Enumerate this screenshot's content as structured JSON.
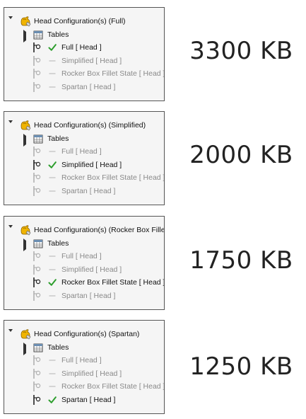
{
  "panels": [
    {
      "root_label": "Head Configuration(s)  (Full)",
      "tables_label": "Tables",
      "configs": [
        {
          "label": "Full [ Head ]",
          "active": true
        },
        {
          "label": "Simplified [ Head ]",
          "active": false
        },
        {
          "label": "Rocker Box Fillet State [ Head ]",
          "active": false
        },
        {
          "label": "Spartan [ Head ]",
          "active": false
        }
      ],
      "size": "3300 KB"
    },
    {
      "root_label": "Head Configuration(s)  (Simplified)",
      "tables_label": "Tables",
      "configs": [
        {
          "label": "Full [ Head ]",
          "active": false
        },
        {
          "label": "Simplified [ Head ]",
          "active": true
        },
        {
          "label": "Rocker Box Fillet State [ Head ]",
          "active": false
        },
        {
          "label": "Spartan [ Head ]",
          "active": false
        }
      ],
      "size": "2000 KB"
    },
    {
      "root_label": "Head Configuration(s)  (Rocker Box Fillet",
      "tables_label": "Tables",
      "configs": [
        {
          "label": "Full [ Head ]",
          "active": false
        },
        {
          "label": "Simplified [ Head ]",
          "active": false
        },
        {
          "label": "Rocker Box Fillet State [ Head ]",
          "active": true
        },
        {
          "label": "Spartan [ Head ]",
          "active": false
        }
      ],
      "size": "1750 KB"
    },
    {
      "root_label": "Head Configuration(s)  (Spartan)",
      "tables_label": "Tables",
      "configs": [
        {
          "label": "Full [ Head ]",
          "active": false
        },
        {
          "label": "Simplified [ Head ]",
          "active": false
        },
        {
          "label": "Rocker Box Fillet State [ Head ]",
          "active": false
        },
        {
          "label": "Spartan [ Head ]",
          "active": true
        }
      ],
      "size": "1250 KB"
    }
  ],
  "colors": {
    "check": "#2e9e2e",
    "config_icon": "#f0b400",
    "inactive_text": "#8a8a8a",
    "panel_border": "#555555"
  },
  "icons": {
    "root": "configuration-icon",
    "tables": "design-table-icon",
    "branch": "configuration-branch-icon",
    "active_mark": "checkmark-icon",
    "inactive_mark": "dash-icon"
  }
}
